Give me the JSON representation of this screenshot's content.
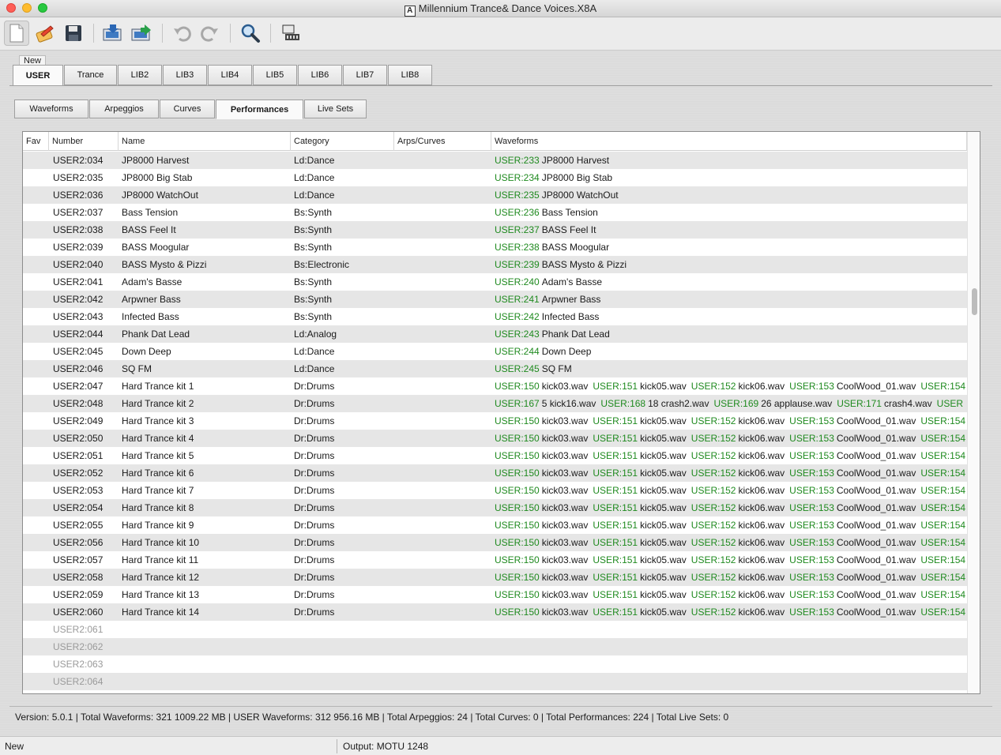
{
  "window": {
    "title": "Millennium Trance& Dance Voices.X8A",
    "app_icon_letter": "A"
  },
  "toolbar": {
    "buttons": [
      {
        "name": "new-document",
        "icon": "new-document-icon"
      },
      {
        "name": "open",
        "icon": "edit-icon"
      },
      {
        "name": "save",
        "icon": "save-icon"
      },
      {
        "name": "receive",
        "icon": "receive-icon"
      },
      {
        "name": "send",
        "icon": "send-icon"
      },
      {
        "name": "undo",
        "icon": "undo-icon"
      },
      {
        "name": "redo",
        "icon": "redo-icon"
      },
      {
        "name": "search",
        "icon": "search-icon"
      },
      {
        "name": "device",
        "icon": "device-icon"
      }
    ]
  },
  "library_tabs": {
    "new_label": "New",
    "tabs": [
      "USER",
      "Trance",
      "LIB2",
      "LIB3",
      "LIB4",
      "LIB5",
      "LIB6",
      "LIB7",
      "LIB8"
    ],
    "active": "USER"
  },
  "sub_tabs": {
    "tabs": [
      "Waveforms",
      "Arpeggios",
      "Curves",
      "Performances",
      "Live Sets"
    ],
    "active": "Performances"
  },
  "table": {
    "columns": [
      "Fav",
      "Number",
      "Name",
      "Category",
      "Arps/Curves",
      "Waveforms"
    ],
    "rows": [
      {
        "number": "USER2:034",
        "name": "JP8000 Harvest",
        "category": "Ld:Dance",
        "waveforms": [
          [
            "USER:233",
            "JP8000 Harvest"
          ]
        ]
      },
      {
        "number": "USER2:035",
        "name": "JP8000 Big Stab",
        "category": "Ld:Dance",
        "waveforms": [
          [
            "USER:234",
            "JP8000 Big Stab"
          ]
        ]
      },
      {
        "number": "USER2:036",
        "name": "JP8000 WatchOut",
        "category": "Ld:Dance",
        "waveforms": [
          [
            "USER:235",
            "JP8000 WatchOut"
          ]
        ]
      },
      {
        "number": "USER2:037",
        "name": "Bass Tension",
        "category": "Bs:Synth",
        "waveforms": [
          [
            "USER:236",
            "Bass Tension"
          ]
        ]
      },
      {
        "number": "USER2:038",
        "name": "BASS Feel It",
        "category": "Bs:Synth",
        "waveforms": [
          [
            "USER:237",
            "BASS Feel It"
          ]
        ]
      },
      {
        "number": "USER2:039",
        "name": "BASS Moogular",
        "category": "Bs:Synth",
        "waveforms": [
          [
            "USER:238",
            "BASS Moogular"
          ]
        ]
      },
      {
        "number": "USER2:040",
        "name": "BASS Mysto & Pizzi",
        "category": "Bs:Electronic",
        "waveforms": [
          [
            "USER:239",
            "BASS  Mysto & Pizzi"
          ]
        ]
      },
      {
        "number": "USER2:041",
        "name": "Adam's Basse",
        "category": "Bs:Synth",
        "waveforms": [
          [
            "USER:240",
            "Adam's Basse"
          ]
        ]
      },
      {
        "number": "USER2:042",
        "name": "Arpwner Bass",
        "category": "Bs:Synth",
        "waveforms": [
          [
            "USER:241",
            "Arpwner Bass"
          ]
        ]
      },
      {
        "number": "USER2:043",
        "name": "Infected Bass",
        "category": "Bs:Synth",
        "waveforms": [
          [
            "USER:242",
            "Infected Bass"
          ]
        ]
      },
      {
        "number": "USER2:044",
        "name": "Phank Dat Lead",
        "category": "Ld:Analog",
        "waveforms": [
          [
            "USER:243",
            "Phank Dat Lead"
          ]
        ]
      },
      {
        "number": "USER2:045",
        "name": "Down Deep",
        "category": "Ld:Dance",
        "waveforms": [
          [
            "USER:244",
            "Down Deep"
          ]
        ]
      },
      {
        "number": "USER2:046",
        "name": "SQ FM",
        "category": "Ld:Dance",
        "waveforms": [
          [
            "USER:245",
            "SQ FM"
          ]
        ]
      },
      {
        "number": "USER2:047",
        "name": "Hard Trance kit 1",
        "category": "Dr:Drums",
        "waveforms": [
          [
            "USER:150",
            "kick03.wav"
          ],
          [
            "USER:151",
            "kick05.wav"
          ],
          [
            "USER:152",
            "kick06.wav"
          ],
          [
            "USER:153",
            "CoolWood_01.wav"
          ],
          [
            "USER:154",
            ""
          ]
        ]
      },
      {
        "number": "USER2:048",
        "name": "Hard Trance kit 2",
        "category": "Dr:Drums",
        "waveforms": [
          [
            "USER:167",
            "5 kick16.wav"
          ],
          [
            "USER:168",
            "18  crash2.wav"
          ],
          [
            "USER:169",
            "26  applause.wav"
          ],
          [
            "USER:171",
            "crash4.wav"
          ],
          [
            "USER",
            ""
          ]
        ]
      },
      {
        "number": "USER2:049",
        "name": "Hard Trance kit 3",
        "category": "Dr:Drums",
        "waveforms": [
          [
            "USER:150",
            "kick03.wav"
          ],
          [
            "USER:151",
            "kick05.wav"
          ],
          [
            "USER:152",
            "kick06.wav"
          ],
          [
            "USER:153",
            "CoolWood_01.wav"
          ],
          [
            "USER:154",
            ""
          ]
        ]
      },
      {
        "number": "USER2:050",
        "name": "Hard Trance kit 4",
        "category": "Dr:Drums",
        "waveforms": [
          [
            "USER:150",
            "kick03.wav"
          ],
          [
            "USER:151",
            "kick05.wav"
          ],
          [
            "USER:152",
            "kick06.wav"
          ],
          [
            "USER:153",
            "CoolWood_01.wav"
          ],
          [
            "USER:154",
            ""
          ]
        ]
      },
      {
        "number": "USER2:051",
        "name": "Hard Trance kit 5",
        "category": "Dr:Drums",
        "waveforms": [
          [
            "USER:150",
            "kick03.wav"
          ],
          [
            "USER:151",
            "kick05.wav"
          ],
          [
            "USER:152",
            "kick06.wav"
          ],
          [
            "USER:153",
            "CoolWood_01.wav"
          ],
          [
            "USER:154",
            ""
          ]
        ]
      },
      {
        "number": "USER2:052",
        "name": "Hard Trance kit 6",
        "category": "Dr:Drums",
        "waveforms": [
          [
            "USER:150",
            "kick03.wav"
          ],
          [
            "USER:151",
            "kick05.wav"
          ],
          [
            "USER:152",
            "kick06.wav"
          ],
          [
            "USER:153",
            "CoolWood_01.wav"
          ],
          [
            "USER:154",
            ""
          ]
        ]
      },
      {
        "number": "USER2:053",
        "name": "Hard Trance kit 7",
        "category": "Dr:Drums",
        "waveforms": [
          [
            "USER:150",
            "kick03.wav"
          ],
          [
            "USER:151",
            "kick05.wav"
          ],
          [
            "USER:152",
            "kick06.wav"
          ],
          [
            "USER:153",
            "CoolWood_01.wav"
          ],
          [
            "USER:154",
            ""
          ]
        ]
      },
      {
        "number": "USER2:054",
        "name": "Hard Trance kit 8",
        "category": "Dr:Drums",
        "waveforms": [
          [
            "USER:150",
            "kick03.wav"
          ],
          [
            "USER:151",
            "kick05.wav"
          ],
          [
            "USER:152",
            "kick06.wav"
          ],
          [
            "USER:153",
            "CoolWood_01.wav"
          ],
          [
            "USER:154",
            ""
          ]
        ]
      },
      {
        "number": "USER2:055",
        "name": "Hard Trance kit 9",
        "category": "Dr:Drums",
        "waveforms": [
          [
            "USER:150",
            "kick03.wav"
          ],
          [
            "USER:151",
            "kick05.wav"
          ],
          [
            "USER:152",
            "kick06.wav"
          ],
          [
            "USER:153",
            "CoolWood_01.wav"
          ],
          [
            "USER:154",
            ""
          ]
        ]
      },
      {
        "number": "USER2:056",
        "name": "Hard Trance kit 10",
        "category": "Dr:Drums",
        "waveforms": [
          [
            "USER:150",
            "kick03.wav"
          ],
          [
            "USER:151",
            "kick05.wav"
          ],
          [
            "USER:152",
            "kick06.wav"
          ],
          [
            "USER:153",
            "CoolWood_01.wav"
          ],
          [
            "USER:154",
            ""
          ]
        ]
      },
      {
        "number": "USER2:057",
        "name": "Hard Trance kit 11",
        "category": "Dr:Drums",
        "waveforms": [
          [
            "USER:150",
            "kick03.wav"
          ],
          [
            "USER:151",
            "kick05.wav"
          ],
          [
            "USER:152",
            "kick06.wav"
          ],
          [
            "USER:153",
            "CoolWood_01.wav"
          ],
          [
            "USER:154",
            ""
          ]
        ]
      },
      {
        "number": "USER2:058",
        "name": "Hard Trance kit 12",
        "category": "Dr:Drums",
        "waveforms": [
          [
            "USER:150",
            "kick03.wav"
          ],
          [
            "USER:151",
            "kick05.wav"
          ],
          [
            "USER:152",
            "kick06.wav"
          ],
          [
            "USER:153",
            "CoolWood_01.wav"
          ],
          [
            "USER:154",
            ""
          ]
        ]
      },
      {
        "number": "USER2:059",
        "name": "Hard Trance kit 13",
        "category": "Dr:Drums",
        "waveforms": [
          [
            "USER:150",
            "kick03.wav"
          ],
          [
            "USER:151",
            "kick05.wav"
          ],
          [
            "USER:152",
            "kick06.wav"
          ],
          [
            "USER:153",
            "CoolWood_01.wav"
          ],
          [
            "USER:154",
            ""
          ]
        ]
      },
      {
        "number": "USER2:060",
        "name": "Hard Trance kit 14",
        "category": "Dr:Drums",
        "waveforms": [
          [
            "USER:150",
            "kick03.wav"
          ],
          [
            "USER:151",
            "kick05.wav"
          ],
          [
            "USER:152",
            "kick06.wav"
          ],
          [
            "USER:153",
            "CoolWood_01.wav"
          ],
          [
            "USER:154",
            ""
          ]
        ]
      },
      {
        "number": "USER2:061",
        "name": "",
        "category": "",
        "waveforms": [],
        "empty": true
      },
      {
        "number": "USER2:062",
        "name": "",
        "category": "",
        "waveforms": [],
        "empty": true
      },
      {
        "number": "USER2:063",
        "name": "",
        "category": "",
        "waveforms": [],
        "empty": true
      },
      {
        "number": "USER2:064",
        "name": "",
        "category": "",
        "waveforms": [],
        "empty": true
      }
    ]
  },
  "summary": {
    "text": "Version: 5.0.1    |    Total Waveforms: 321   1009.22 MB    |    USER  Waveforms: 312   956.16 MB    |    Total Arpeggios: 24    |    Total Curves: 0    |    Total Performances: 224    |    Total Live Sets: 0"
  },
  "statusbar": {
    "left": "New",
    "right": "Output: MOTU 1248"
  },
  "colors": {
    "waveform_id": "#1f8a1f",
    "row_alt": "#e6e6e6",
    "empty_number": "#9a9a9a"
  }
}
